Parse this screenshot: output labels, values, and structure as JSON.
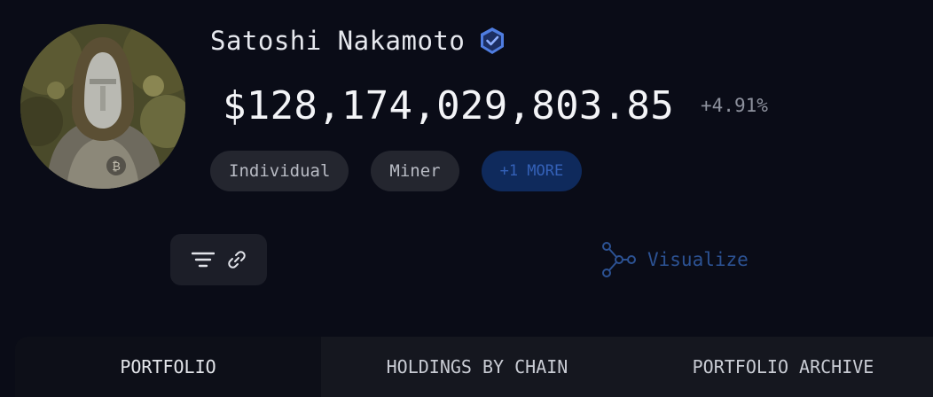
{
  "profile": {
    "name": "Satoshi Nakamoto",
    "verified_icon": "verified-shield-icon",
    "total_value": "$128,174,029,803.85",
    "change": "+4.91%",
    "tags": [
      "Individual",
      "Miner",
      "+1 MORE"
    ]
  },
  "toolbar": {
    "filter_icon": "filter-icon",
    "link_icon": "link-icon"
  },
  "visualize": {
    "label": "Visualize",
    "icon": "graph-nodes-icon"
  },
  "tabs": [
    {
      "label": "PORTFOLIO",
      "active": true
    },
    {
      "label": "HOLDINGS BY CHAIN",
      "active": false
    },
    {
      "label": "PORTFOLIO ARCHIVE",
      "active": false
    }
  ],
  "colors": {
    "background": "#0a0c17",
    "accent_blue": "#2c5293",
    "more_tag_bg": "#0f2a5c",
    "verified_blue": "#4f7de0"
  }
}
